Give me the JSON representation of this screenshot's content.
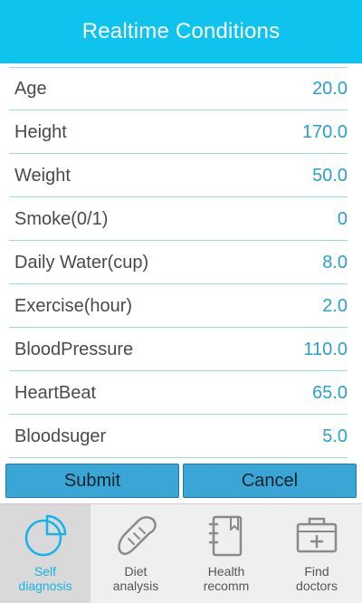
{
  "header": {
    "title": "Realtime Conditions"
  },
  "fields": [
    {
      "label": "Age",
      "value": "20.0"
    },
    {
      "label": "Height",
      "value": "170.0"
    },
    {
      "label": "Weight",
      "value": "50.0"
    },
    {
      "label": "Smoke(0/1)",
      "value": "0"
    },
    {
      "label": "Daily Water(cup)",
      "value": "8.0"
    },
    {
      "label": "Exercise(hour)",
      "value": "2.0"
    },
    {
      "label": "BloodPressure",
      "value": "110.0"
    },
    {
      "label": "HeartBeat",
      "value": "65.0"
    },
    {
      "label": "Bloodsuger",
      "value": "5.0"
    }
  ],
  "actions": {
    "submit_label": "Submit",
    "cancel_label": "Cancel"
  },
  "tabs": [
    {
      "label": "Self\ndiagnosis",
      "icon": "pie-chart-icon",
      "active": true
    },
    {
      "label": "Diet\nanalysis",
      "icon": "bread-icon",
      "active": false
    },
    {
      "label": "Health\nrecomm",
      "icon": "notebook-icon",
      "active": false
    },
    {
      "label": "Find\ndoctors",
      "icon": "medical-kit-icon",
      "active": false
    }
  ],
  "colors": {
    "header": "#0fc3ef",
    "accent": "#15b4e8",
    "value_text": "#2a9fd0",
    "button": "#3aa6d6"
  }
}
